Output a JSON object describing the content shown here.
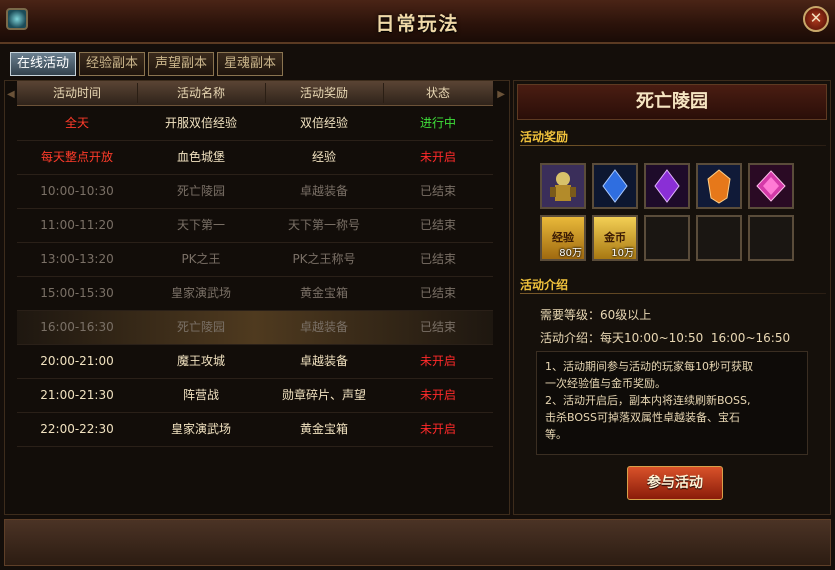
{
  "window": {
    "title": "日常玩法",
    "close_glyph": "✕"
  },
  "tabs": [
    {
      "label": "在线活动",
      "active": true
    },
    {
      "label": "经验副本",
      "active": false
    },
    {
      "label": "声望副本",
      "active": false
    },
    {
      "label": "星魂副本",
      "active": false
    }
  ],
  "table": {
    "headers": [
      "活动时间",
      "活动名称",
      "活动奖励",
      "状态"
    ],
    "rows": [
      {
        "time": "全天",
        "name": "开服双倍经验",
        "reward": "双倍经验",
        "status": "进行中"
      },
      {
        "time": "每天整点开放",
        "name": "血色城堡",
        "reward": "经验",
        "status": "未开启"
      },
      {
        "time": "10:00-10:30",
        "name": "死亡陵园",
        "reward": "卓越装备",
        "status": "已结束"
      },
      {
        "time": "11:00-11:20",
        "name": "天下第一",
        "reward": "天下第一称号",
        "status": "已结束"
      },
      {
        "time": "13:00-13:20",
        "name": "PK之王",
        "reward": "PK之王称号",
        "status": "已结束"
      },
      {
        "time": "15:00-15:30",
        "name": "皇家演武场",
        "reward": "黄金宝箱",
        "status": "已结束"
      },
      {
        "time": "16:00-16:30",
        "name": "死亡陵园",
        "reward": "卓越装备",
        "status": "已结束"
      },
      {
        "time": "20:00-21:00",
        "name": "魔王攻城",
        "reward": "卓越装备",
        "status": "未开启"
      },
      {
        "time": "21:00-21:30",
        "name": "阵营战",
        "reward": "勋章碎片、声望",
        "status": "未开启"
      },
      {
        "time": "22:00-22:30",
        "name": "皇家演武场",
        "reward": "黄金宝箱",
        "status": "未开启"
      }
    ]
  },
  "detail": {
    "title": "死亡陵园",
    "reward_section_label": "活动奖励",
    "rewards": [
      {
        "icon": "armor-set-icon",
        "amount": ""
      },
      {
        "icon": "blue-gem-icon",
        "amount": ""
      },
      {
        "icon": "purple-gem-icon",
        "amount": ""
      },
      {
        "icon": "orange-gem-icon",
        "amount": ""
      },
      {
        "icon": "pink-gem-icon",
        "amount": ""
      },
      {
        "icon": "exp-icon",
        "label": "经验",
        "amount": "80万"
      },
      {
        "icon": "gold-coin-icon",
        "label": "金币",
        "amount": "10万"
      }
    ],
    "intro_section_label": "活动介绍",
    "level_label": "需要等级：",
    "level_value": "60级以上",
    "intro_label": "活动介绍：",
    "intro_value": "每天10:00~10:50  16:00~16:50",
    "description": [
      "1、活动期间参与活动的玩家每10秒可获取",
      "一次经验值与金币奖励。",
      "2、活动开启后，副本内将连续刷新BOSS,",
      "击杀BOSS可掉落双属性卓越装备、宝石",
      "等。"
    ],
    "join_label": "参与活动"
  },
  "colors": {
    "status_active": "#3fe03a",
    "status_pending": "#ff2a2a",
    "status_ended": "#7a7066",
    "row_text_open": "#f1e2c0",
    "row_text_special": "#ff3b2a"
  }
}
